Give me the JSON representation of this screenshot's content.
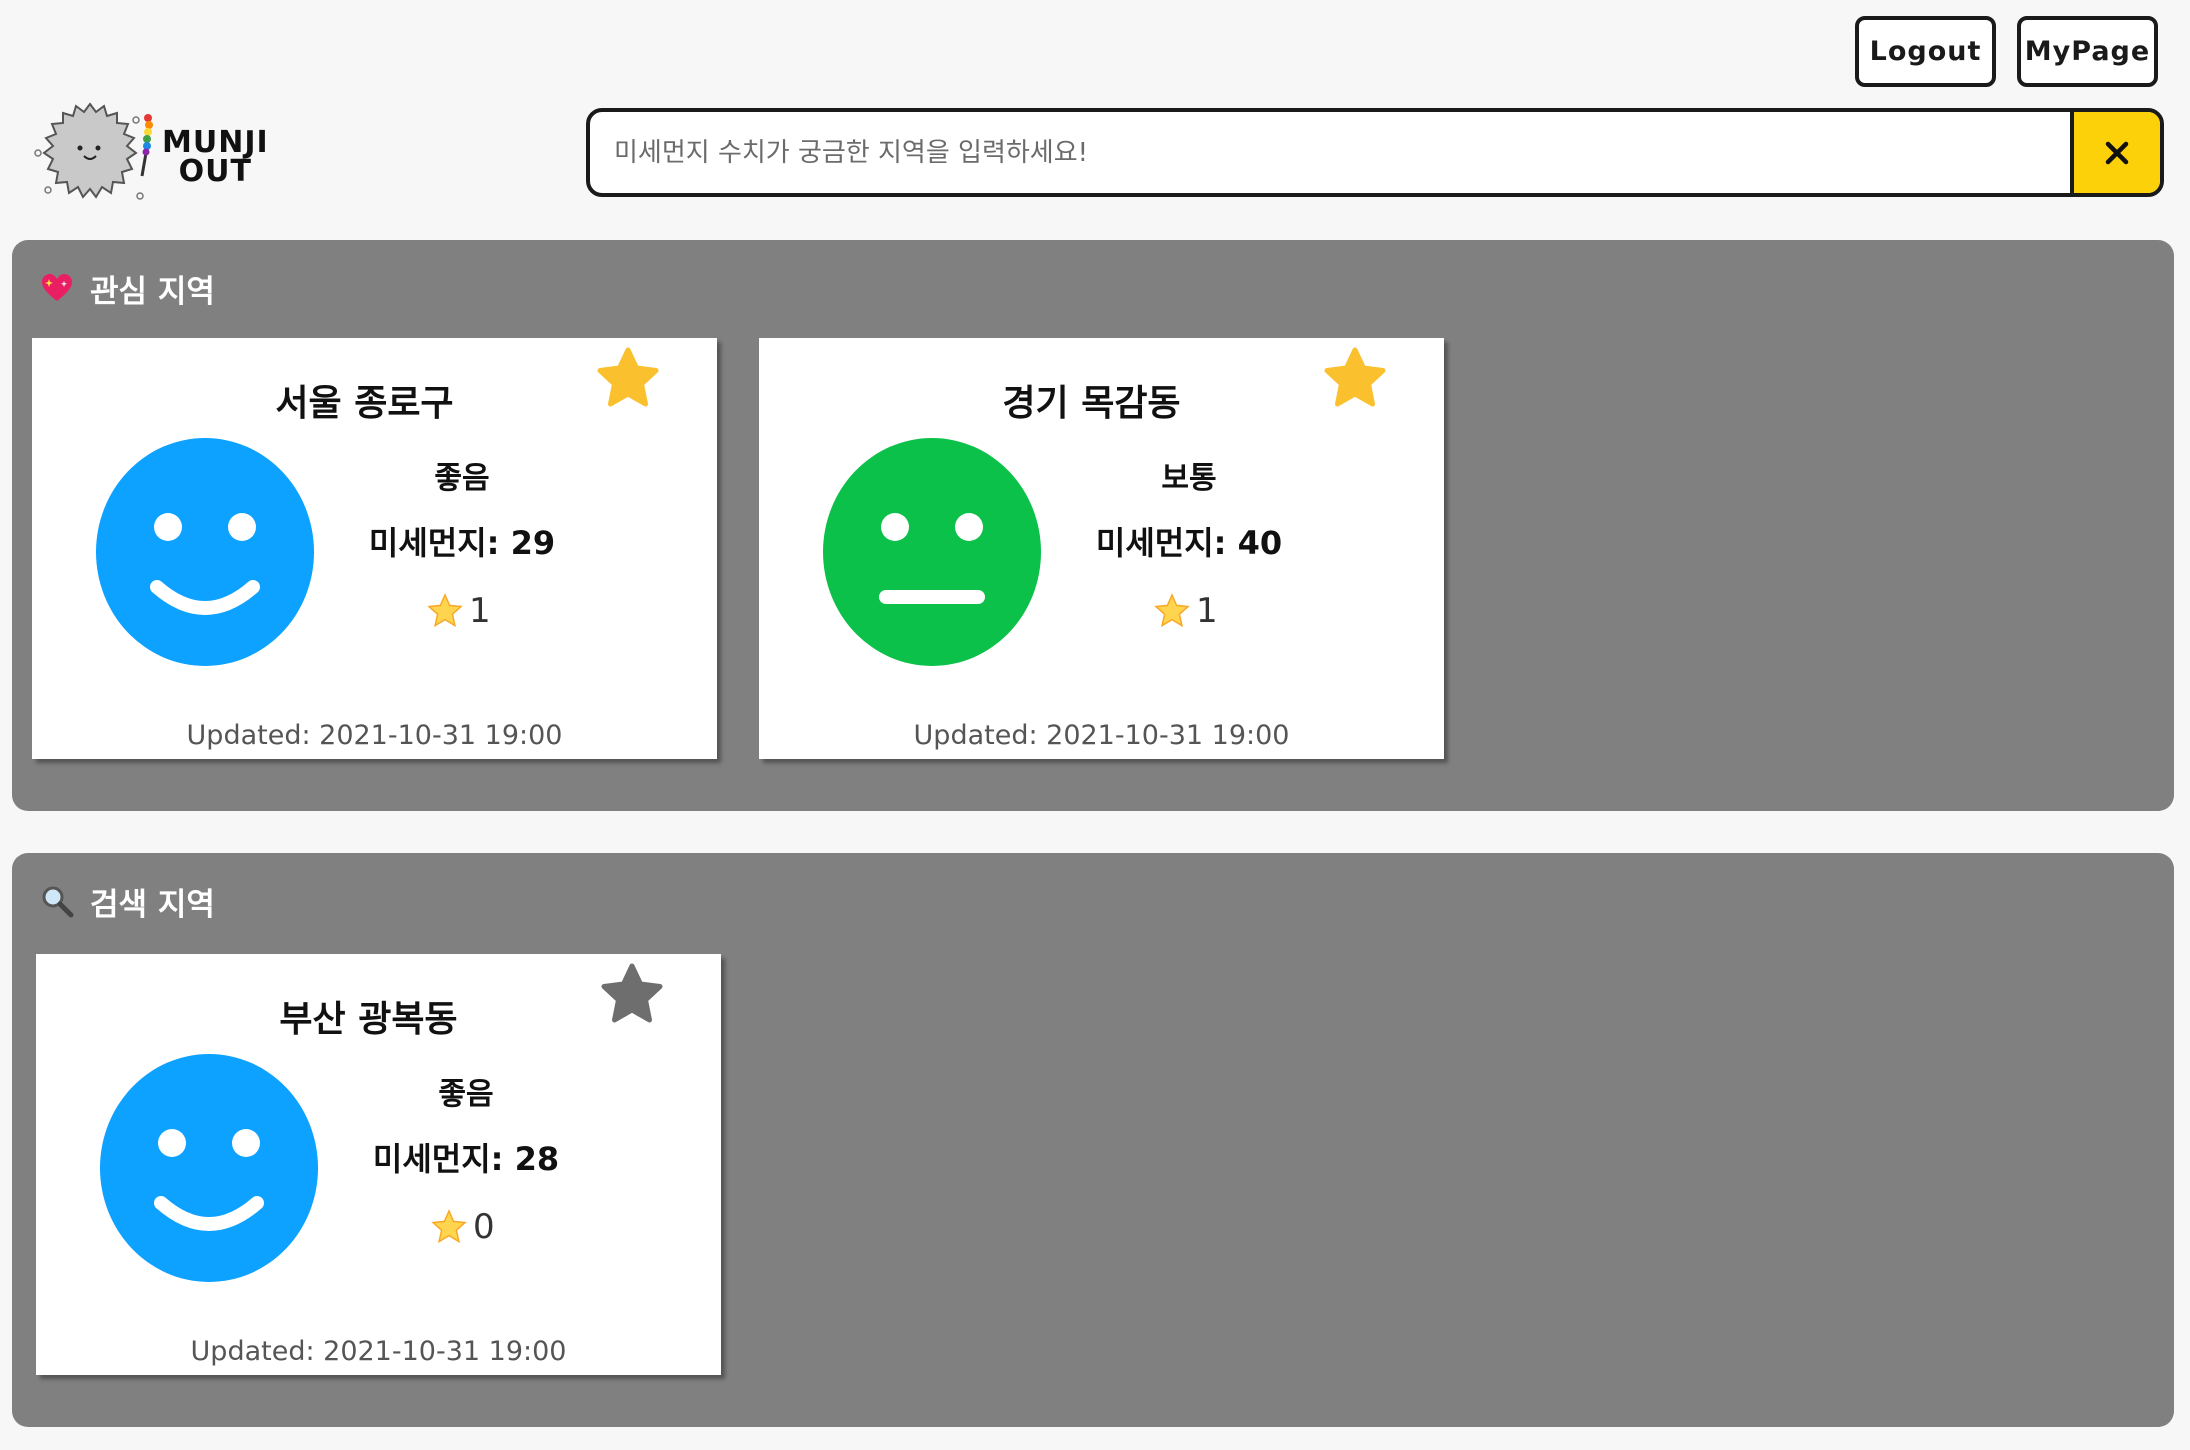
{
  "header": {
    "logout_label": "Logout",
    "mypage_label": "MyPage"
  },
  "logo": {
    "line1": "MUNJI",
    "line2": "OUT"
  },
  "search": {
    "placeholder": "미세먼지 수치가 궁금한 지역을 입력하세요!",
    "value": "",
    "clear_icon": "close-icon"
  },
  "favorites_section": {
    "icon": "sparkling-heart-icon",
    "title": "관심 지역",
    "cards": [
      {
        "name": "서울 종로구",
        "status": "좋음",
        "dust_label": "미세먼지: 29",
        "star_count": "1",
        "updated": "Updated: 2021-10-31 19:00",
        "favorited": true,
        "face": "smile-face-icon",
        "face_color": "#0da2ff"
      },
      {
        "name": "경기 목감동",
        "status": "보통",
        "dust_label": "미세먼지: 40",
        "star_count": "1",
        "updated": "Updated: 2021-10-31 19:00",
        "favorited": true,
        "face": "neutral-face-icon",
        "face_color": "#0cc14a"
      }
    ]
  },
  "search_section": {
    "icon": "magnifier-icon",
    "title": "검색 지역",
    "cards": [
      {
        "name": "부산 광복동",
        "status": "좋음",
        "dust_label": "미세먼지: 28",
        "star_count": "0",
        "updated": "Updated: 2021-10-31 19:00",
        "favorited": false,
        "face": "smile-face-icon",
        "face_color": "#0da2ff"
      }
    ]
  },
  "colors": {
    "section_bg": "#808080",
    "accent_yellow": "#fcd10a",
    "star_active": "#fbc02d",
    "star_inactive": "#6e6e6e",
    "good": "#0da2ff",
    "normal": "#0cc14a"
  }
}
